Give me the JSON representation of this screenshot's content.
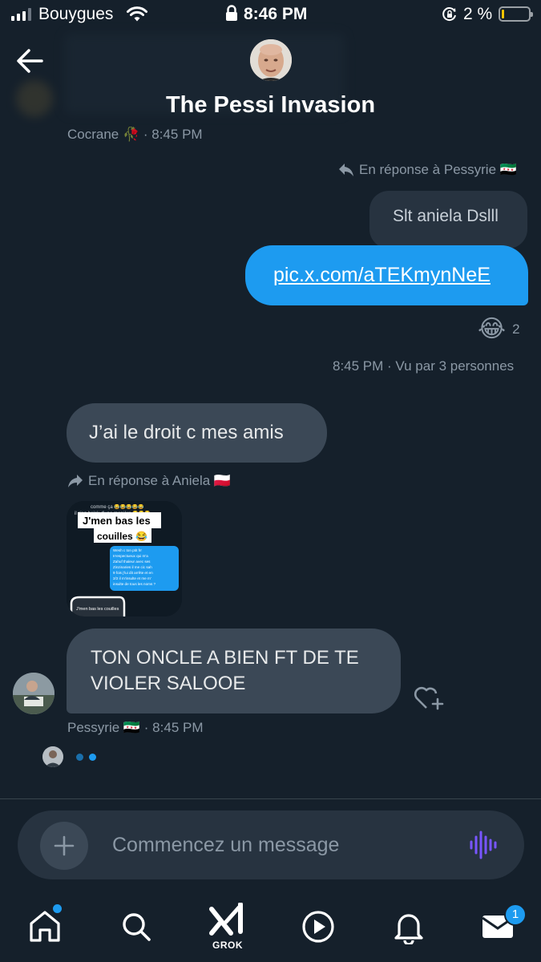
{
  "status_bar": {
    "carrier": "Bouygues",
    "time": "8:46 PM",
    "battery_percent": "2 %",
    "battery_level": 0.02
  },
  "header": {
    "title": "The Pessi Invasion"
  },
  "previous_message": {
    "meta": "Cocrane 🥀 · 8:45 PM"
  },
  "messages": [
    {
      "reply_to": "En réponse à Pessyrie 🇸🇾",
      "quoted_text": "Slt aniela Dslll",
      "text": "pic.x.com/aTEKmynNeE",
      "reaction": {
        "emoji": "😂",
        "count": "2"
      },
      "meta": "8:45 PM · Vu par 3 personnes"
    },
    {
      "text": "J’ai le droit c mes amis"
    },
    {
      "reply_to": "En réponse à Aniela 🇵🇱",
      "image": {
        "lines": [
          "comme ça 😂😂😂😂😂",
          "il s'en balek d'une manière 😂😂😂",
          "J'men bas les",
          "couilles 😂",
          "Wesh c ton ptit frr",
          "Irrespectueux qui m'a",
          "Zahuf thaleur avec ses",
          "Zinzinaries il me cic sah",
          "9 fois j'lui dit arrête et en",
          "2/2 il m'insulte et me m'",
          "insulte de tous les noms ?",
          "J'men bas les couilles"
        ]
      }
    },
    {
      "text": "TON ONCLE A BIEN FT DE TE VIOLER SALOOE",
      "meta": "Pessyrie 🇸🇾 · 8:45 PM"
    }
  ],
  "composer": {
    "placeholder": "Commencez un message"
  },
  "nav": {
    "grok_label": "GROK",
    "messages_badge": "1"
  },
  "colors": {
    "background": "#15202b",
    "accent": "#1d9bf0",
    "bubble_received": "#3b4856",
    "voice_icon": "#7856ff"
  }
}
